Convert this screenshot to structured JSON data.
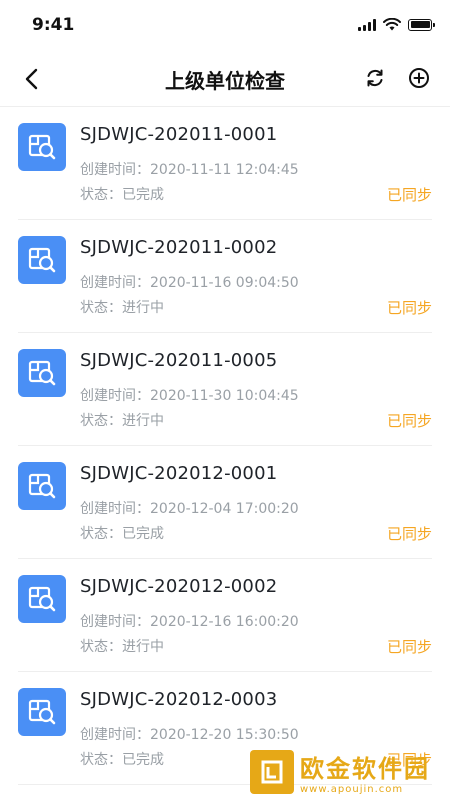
{
  "status_bar": {
    "time": "9:41"
  },
  "nav": {
    "title": "上级单位检查"
  },
  "items": [
    {
      "title": "SJDWJC-202011-0001",
      "time_label": "创建时间：",
      "time": "2020-11-11 12:04:45",
      "status_label": "状态：",
      "status": "已完成",
      "sync": "已同步"
    },
    {
      "title": "SJDWJC-202011-0002",
      "time_label": "创建时间：",
      "time": "2020-11-16 09:04:50",
      "status_label": "状态：",
      "status": "进行中",
      "sync": "已同步"
    },
    {
      "title": "SJDWJC-202011-0005",
      "time_label": "创建时间：",
      "time": "2020-11-30 10:04:45",
      "status_label": "状态：",
      "status": "进行中",
      "sync": "已同步"
    },
    {
      "title": "SJDWJC-202012-0001",
      "time_label": "创建时间：",
      "time": "2020-12-04 17:00:20",
      "status_label": "状态：",
      "status": "已完成",
      "sync": "已同步"
    },
    {
      "title": "SJDWJC-202012-0002",
      "time_label": "创建时间：",
      "time": "2020-12-16 16:00:20",
      "status_label": "状态：",
      "status": "进行中",
      "sync": "已同步"
    },
    {
      "title": "SJDWJC-202012-0003",
      "time_label": "创建时间：",
      "time": "2020-12-20 15:30:50",
      "status_label": "状态：",
      "status": "已完成",
      "sync": "已同步"
    }
  ],
  "watermark": {
    "name": "欧金软件园",
    "url": "www.apoujin.com"
  },
  "colors": {
    "accent": "#4a8ff5",
    "sync": "#f5a623",
    "muted": "#9aa0a6"
  }
}
